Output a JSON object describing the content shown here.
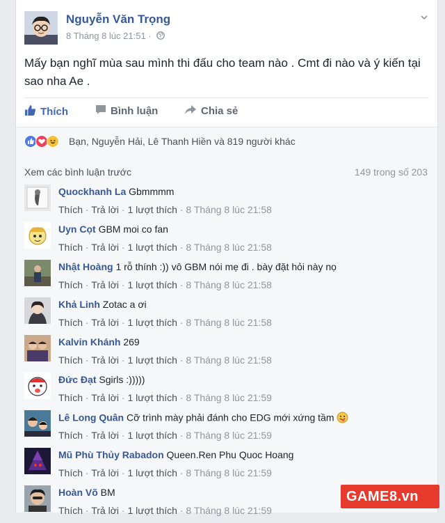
{
  "post": {
    "author": "Nguyễn Văn Trọng",
    "timestamp": "8 Tháng 8 lúc 21:51",
    "separator": "·",
    "text": "Mấy bạn nghĩ mùa sau mình thi đấu cho team nào . Cmt đi nào và ý kiến tại sao nha Ae ."
  },
  "actions": {
    "like": "Thích",
    "comment": "Bình luận",
    "share": "Chia sẻ"
  },
  "reactions": {
    "summary": "Bạn, Nguyễn Hải, Lê Thanh Hiền và 819 người khác",
    "icons": [
      "like-icon",
      "love-icon",
      "haha-icon"
    ],
    "colors": {
      "like": "#4c7bea",
      "love": "#f0405b",
      "haha": "#f7c23b"
    }
  },
  "comments_header": {
    "prev_link": "Xem các bình luận trước",
    "count": "149 trong số 203"
  },
  "comment_actions": {
    "like": "Thích",
    "reply": "Trả lời",
    "likes": "1 lượt thích",
    "dot": "·"
  },
  "comments": [
    {
      "name": "Quockhanh La",
      "text": "Gbmmmm",
      "time": "8 Tháng 8 lúc 21:58"
    },
    {
      "name": "Uyn Cọt",
      "text": "GBM moi co fan",
      "time": "8 Tháng 8 lúc 21:58"
    },
    {
      "name": "Nhật Hoàng",
      "text": "1 rỗ thính :)) vô GBM nói mẹ đi . bày đặt hỏi này nọ",
      "time": "8 Tháng 8 lúc 21:58"
    },
    {
      "name": "Khả Linh",
      "text": "Zotac a ơi",
      "time": "8 Tháng 8 lúc 21:58"
    },
    {
      "name": "Kalvin Khánh",
      "text": "269",
      "time": "8 Tháng 8 lúc 21:58"
    },
    {
      "name": "Đức Đạt",
      "text": "Sgirls :)))))",
      "time": "8 Tháng 8 lúc 21:59"
    },
    {
      "name": "Lê Long Quân",
      "text": "Cỡ trình mày phải đánh cho EDG mới xứng tầm",
      "time": "8 Tháng 8 lúc 21:59"
    },
    {
      "name": "Mũ Phù Thủy Rabadon",
      "text": "Queen.Ren Phu Quoc Hoang",
      "time": "8 Tháng 8 lúc 21:59"
    },
    {
      "name": "Hoàn Võ",
      "text": "BM",
      "time": "8 Tháng 8 lúc 21:59"
    }
  ],
  "watermark": {
    "text": "GAME8.vn"
  }
}
